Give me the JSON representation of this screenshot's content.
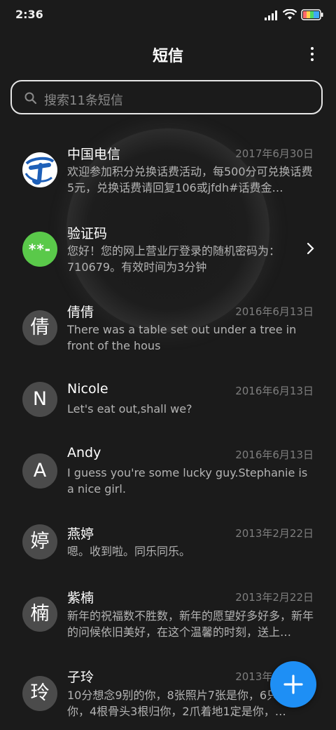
{
  "status_bar": {
    "time": "2:36",
    "battery_color": "#4cd964"
  },
  "header": {
    "title": "短信"
  },
  "search": {
    "placeholder": "搜索11条短信"
  },
  "messages": [
    {
      "name": "中国电信",
      "date": "2017年6月30日",
      "preview": "欢迎参加积分兑换话费活动，每500分可兑换话费5元，兑换话费请回复106或jfdh#话费金…",
      "avatar": "telecom-logo"
    },
    {
      "name": "验证码",
      "date": "",
      "preview": "您好！您的网上营业厅登录的随机密码为：710679。有效时间为3分钟",
      "avatar": "**-",
      "avatar_color": "#5ac94a"
    },
    {
      "name": "倩倩",
      "date": "2016年6月13日",
      "preview": "There was a table set out under a tree in front of the hous",
      "avatar": "倩"
    },
    {
      "name": "Nicole",
      "date": "2016年6月13日",
      "preview": "Let's eat out,shall we?",
      "avatar": "N"
    },
    {
      "name": "Andy",
      "date": "2016年6月13日",
      "preview": "I guess you're some lucky guy.Stephanie is a nice girl.",
      "avatar": "A"
    },
    {
      "name": "燕婷",
      "date": "2013年2月22日",
      "preview": "嗯。收到啦。同乐同乐。",
      "avatar": "婷"
    },
    {
      "name": "紫楠",
      "date": "2013年2月22日",
      "preview": "新年的祝福数不胜数，新年的愿望好多好多，新年的问候依旧美好，在这个温馨的时刻，送上…",
      "avatar": "楠"
    },
    {
      "name": "子玲",
      "date": "2013年2月22日",
      "preview": "10分想念9别的你，8张照片7张是你，6只只像你，4根骨头3根归你，2爪着地1定是你，…",
      "avatar": "玲"
    }
  ],
  "fab": {
    "icon": "plus-icon",
    "color": "#1e8ff5"
  }
}
